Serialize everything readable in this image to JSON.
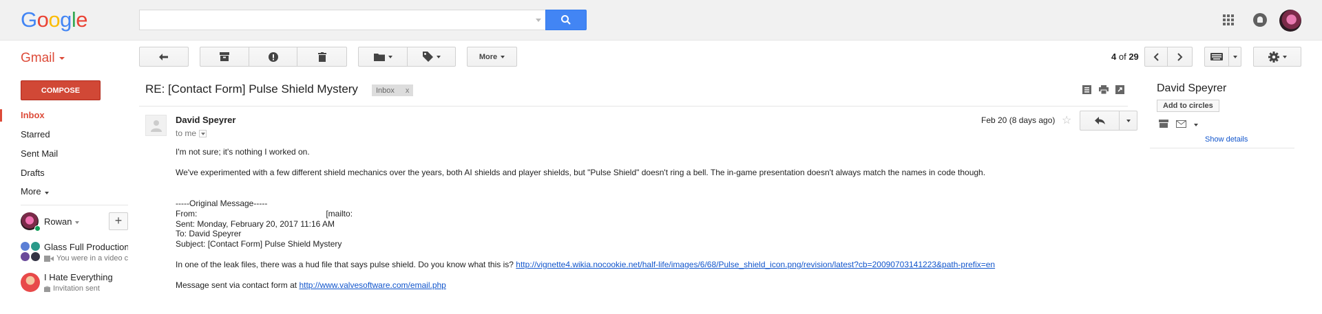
{
  "header": {
    "logo_letters": [
      {
        "ch": "G",
        "color": "#4285f4"
      },
      {
        "ch": "o",
        "color": "#ea4335"
      },
      {
        "ch": "o",
        "color": "#fbbc05"
      },
      {
        "ch": "g",
        "color": "#4285f4"
      },
      {
        "ch": "l",
        "color": "#34a853"
      },
      {
        "ch": "e",
        "color": "#ea4335"
      }
    ],
    "search_value": "",
    "icons": [
      "search-icon",
      "apps-grid-icon",
      "notifications-icon"
    ]
  },
  "toolbar": {
    "product_label": "Gmail",
    "more_label": "More",
    "pager_current": "4",
    "pager_of": "of",
    "pager_total": "29"
  },
  "nav": {
    "compose_label": "COMPOSE",
    "items": [
      {
        "label": "Inbox",
        "active": true
      },
      {
        "label": "Starred"
      },
      {
        "label": "Sent Mail"
      },
      {
        "label": "Drafts"
      },
      {
        "label": "More"
      }
    ]
  },
  "hangouts": {
    "user_name": "Rowan",
    "add_label": "+",
    "conversations": [
      {
        "title": "Glass Full Productions",
        "subtitle": "You were in a video call"
      },
      {
        "title": "I Hate Everything",
        "subtitle": "Invitation sent"
      }
    ]
  },
  "message": {
    "subject": "RE: [Contact Form] Pulse Shield Mystery",
    "label": "Inbox",
    "label_remove": "x",
    "sender": "David Speyrer",
    "to": "to me",
    "date": "Feb 20 (8 days ago)",
    "star": "☆",
    "body": {
      "p1": "I'm not sure; it's nothing I worked on.",
      "p2": "We've experimented with a few different shield mechanics over the years, both AI shields and player shields, but \"Pulse Shield\" doesn't ring a bell. The in-game presentation doesn't always match the names in code though.",
      "orig_header": "-----Original Message-----",
      "from_label": "From:",
      "from_mailto": "[mailto:",
      "sent": "Sent: Monday, February 20, 2017 11:16 AM",
      "to_line": "To: David Speyrer",
      "subject_line": "Subject: [Contact Form] Pulse Shield Mystery",
      "p3_prefix": "In one of the leak files, there was a hud file that says pulse shield. Do you know what this is?",
      "p3_link": "http://vignette4.wikia.nocookie.net/half-life/images/6/68/Pulse_shield_icon.png/revision/latest?cb=20090703141223&path-prefix=en",
      "p4_prefix": "Message sent via contact form at",
      "p4_link": "http://www.valvesoftware.com/email.php"
    }
  },
  "contact": {
    "name": "David Speyrer",
    "add_to_circles": "Add to circles",
    "show_details": "Show details"
  },
  "colors": {
    "accent_red": "#dd4b39",
    "compose_bg": "#d14836",
    "search_blue": "#4285f4",
    "link": "#1155cc"
  }
}
